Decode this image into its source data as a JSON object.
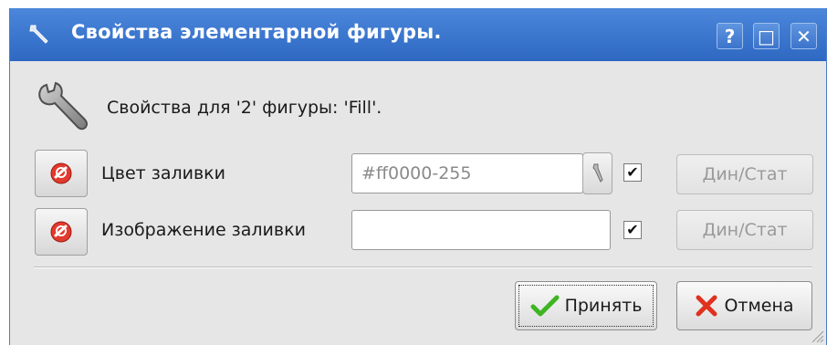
{
  "window": {
    "title": "Свойства элементарной фигуры.",
    "controls": {
      "help": "?",
      "maximize": "□",
      "close": "✕"
    }
  },
  "header": {
    "text": "Свойства для '2' фигуры: 'Fill'."
  },
  "rows": [
    {
      "label": "Цвет заливки",
      "value": "#ff0000-255",
      "checked": true,
      "dyn_label": "Дин/Стат"
    },
    {
      "label": "Изображение заливки",
      "value": "",
      "checked": true,
      "dyn_label": "Дин/Стат"
    }
  ],
  "buttons": {
    "accept": "Принять",
    "cancel": "Отмена"
  },
  "colors": {
    "titlebar": "#3a76d0",
    "accept_icon": "#3cb521",
    "cancel_icon": "#e0311f",
    "reset_icon": "#e23a2e"
  }
}
